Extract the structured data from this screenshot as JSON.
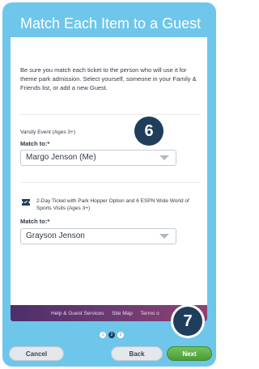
{
  "header": {
    "title": "Match Each Item to a Guest"
  },
  "intro": {
    "text": "Be sure you match each ticket to the person who will use it for theme park admission. Select yourself, someone in your Family & Friends list, or add a new Guest."
  },
  "items": [
    {
      "section_label": "Varsity Event (Ages 3+)",
      "match_label": "Match to:*",
      "selected_guest": "Margo Jenson (Me)"
    },
    {
      "section_label": "2-Day Ticket with Park Hopper Option and 6 ESPN Wide World of Sports Visits (Ages 3+)",
      "match_label": "Match to:*",
      "selected_guest": "Grayson Jenson"
    }
  ],
  "footer": {
    "links": [
      "Help & Guest Services",
      "Site Map",
      "Terms o"
    ]
  },
  "pagination": {
    "pages": [
      "1",
      "2",
      "3"
    ],
    "current": "2"
  },
  "buttons": {
    "cancel": "Cancel",
    "back": "Back",
    "next": "Next"
  },
  "callouts": {
    "first": "6",
    "second": "7"
  },
  "colors": {
    "header": "#6ec6ea",
    "badge": "#1f3e5b",
    "next_button": "#5aae45",
    "footer": "#6b3a72"
  }
}
